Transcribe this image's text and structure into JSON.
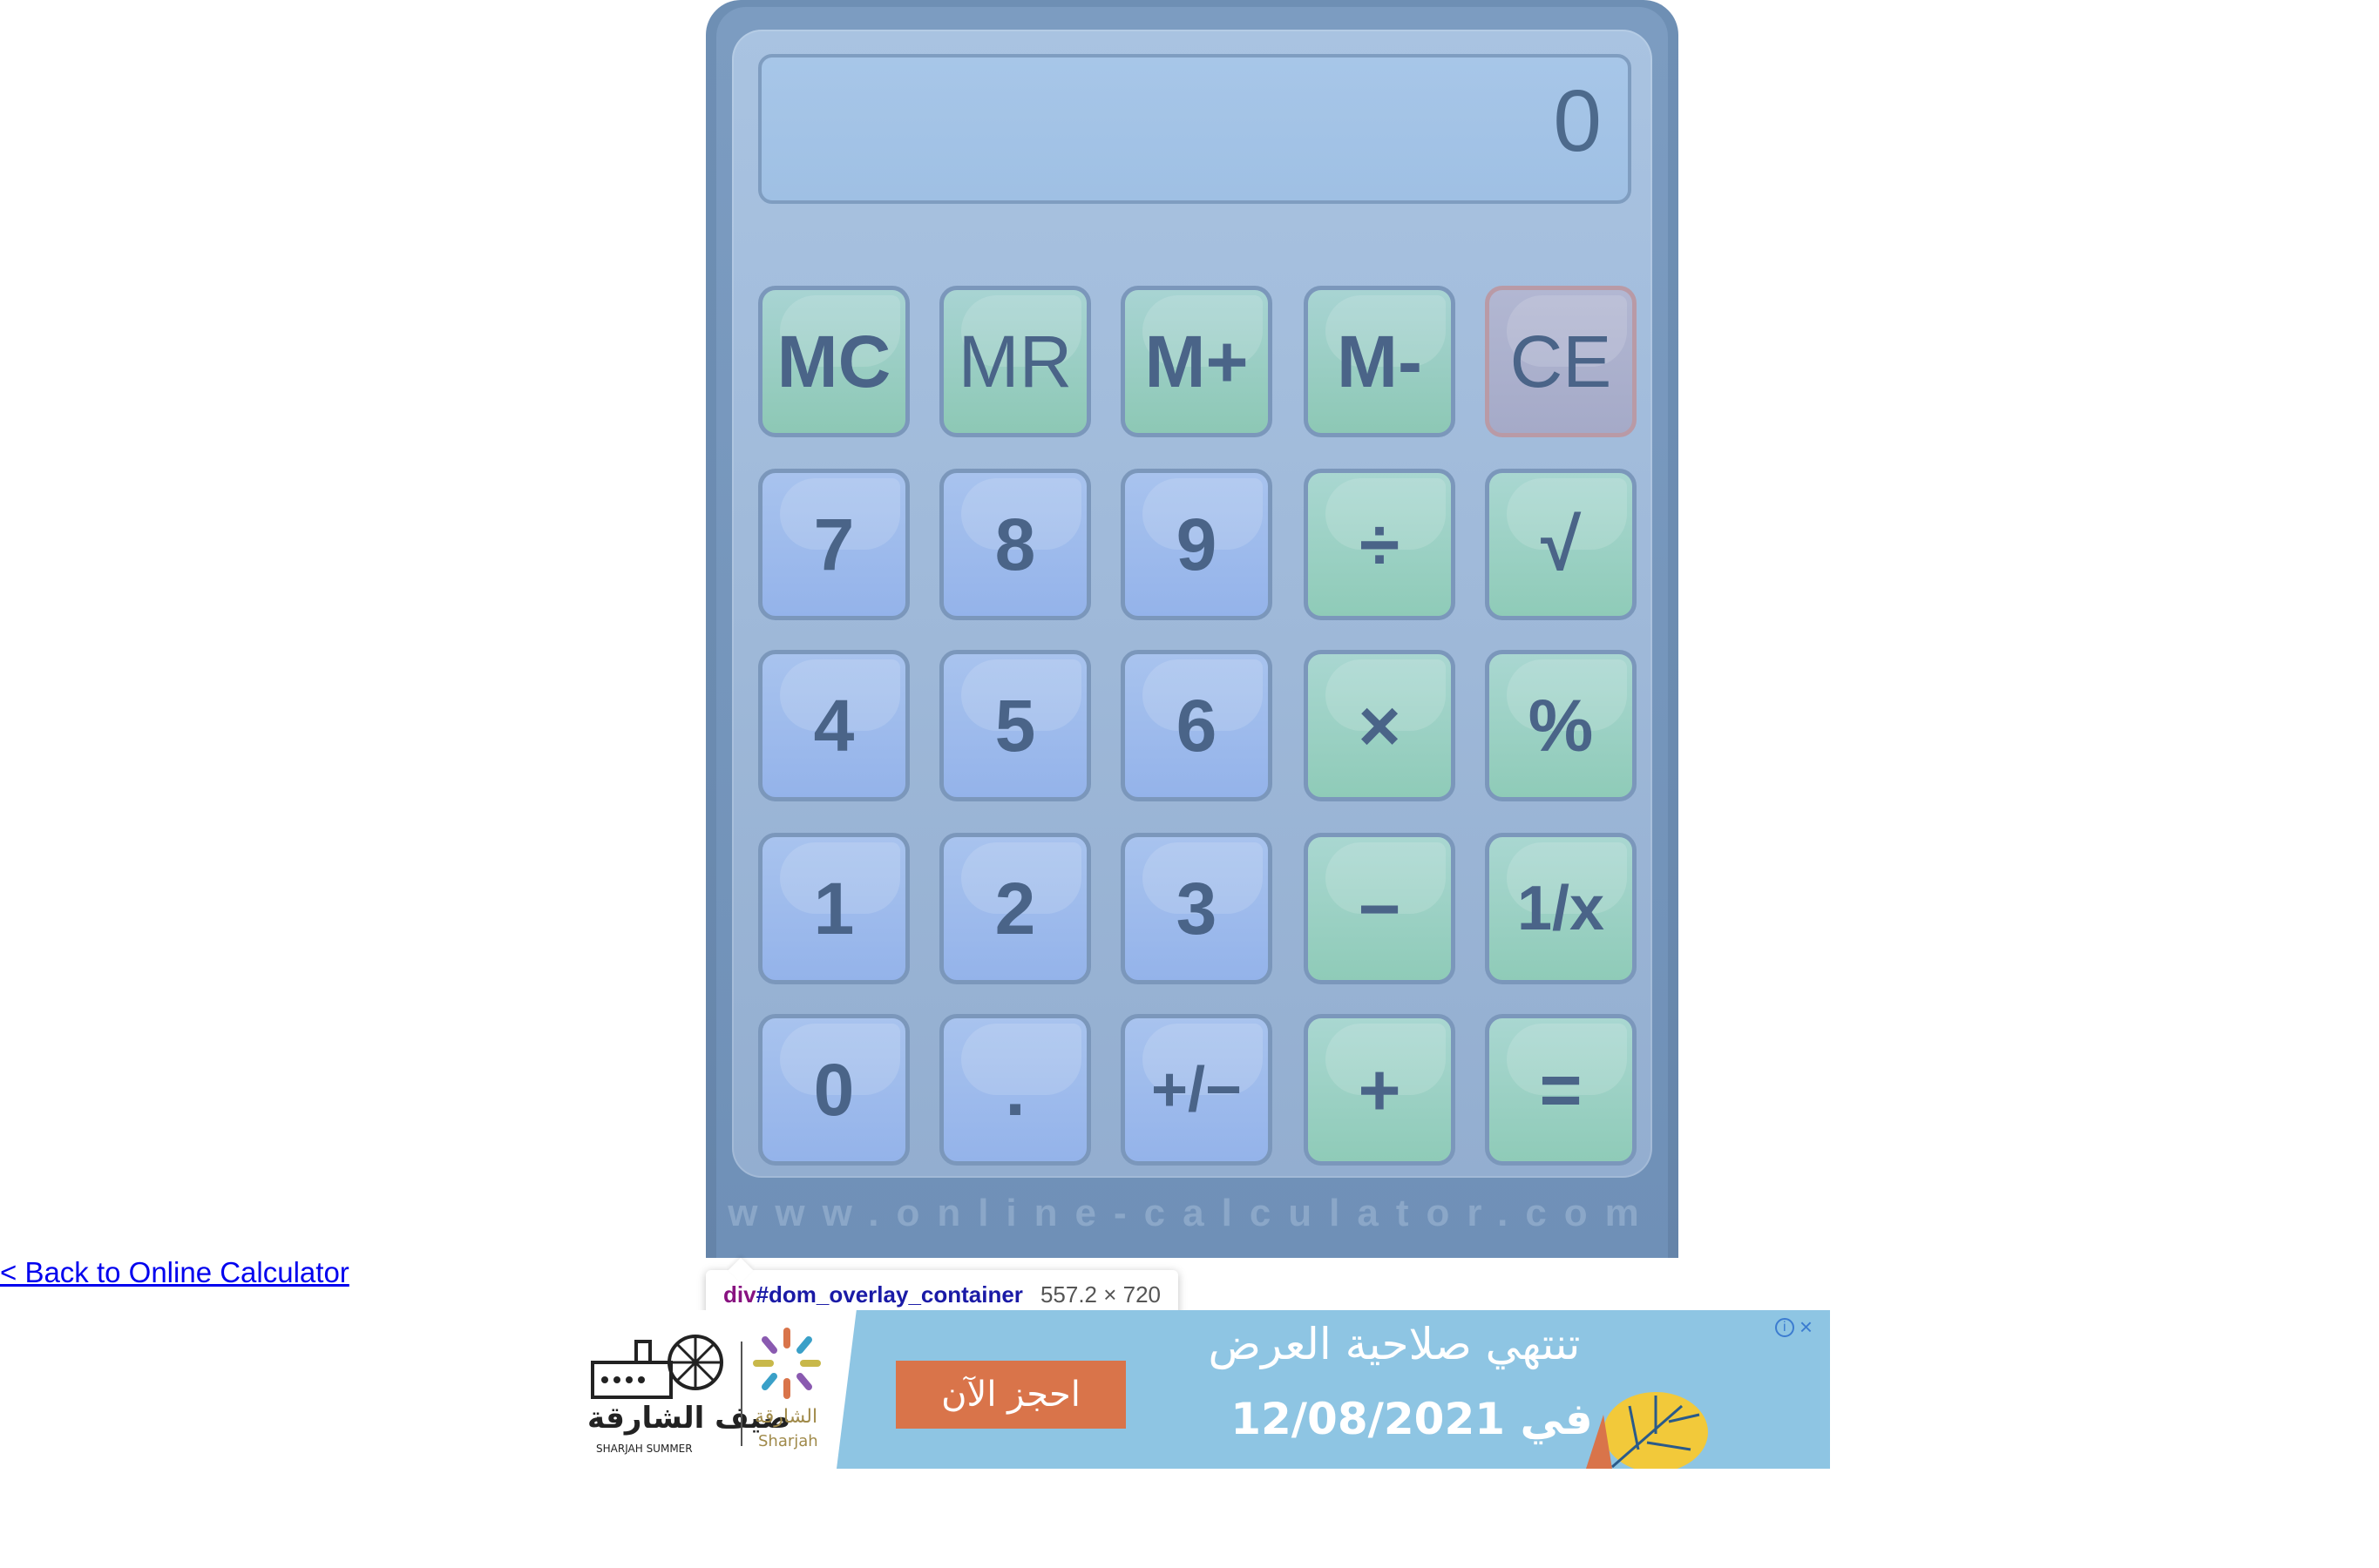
{
  "calculator": {
    "display_value": "0",
    "watermark": "www.online-calculator.com",
    "keys": [
      {
        "label": "MC",
        "name": "memory-clear-button",
        "type": "mem"
      },
      {
        "label": "MR",
        "name": "memory-recall-button",
        "type": "mem light"
      },
      {
        "label": "M+",
        "name": "memory-add-button",
        "type": "mem"
      },
      {
        "label": "M-",
        "name": "memory-subtract-button",
        "type": "mem"
      },
      {
        "label": "CE",
        "name": "clear-entry-button",
        "type": "ce"
      },
      {
        "label": "7",
        "name": "digit-7-button",
        "type": "num"
      },
      {
        "label": "8",
        "name": "digit-8-button",
        "type": "num"
      },
      {
        "label": "9",
        "name": "digit-9-button",
        "type": "num"
      },
      {
        "label": "÷",
        "name": "divide-button",
        "type": "op"
      },
      {
        "label": "√",
        "name": "square-root-button",
        "type": "op"
      },
      {
        "label": "4",
        "name": "digit-4-button",
        "type": "num"
      },
      {
        "label": "5",
        "name": "digit-5-button",
        "type": "num"
      },
      {
        "label": "6",
        "name": "digit-6-button",
        "type": "num"
      },
      {
        "label": "×",
        "name": "multiply-button",
        "type": "op"
      },
      {
        "label": "%",
        "name": "percent-button",
        "type": "op"
      },
      {
        "label": "1",
        "name": "digit-1-button",
        "type": "num"
      },
      {
        "label": "2",
        "name": "digit-2-button",
        "type": "num"
      },
      {
        "label": "3",
        "name": "digit-3-button",
        "type": "num"
      },
      {
        "label": "−",
        "name": "subtract-button",
        "type": "op"
      },
      {
        "label": "1/x",
        "name": "reciprocal-button",
        "type": "op"
      },
      {
        "label": "0",
        "name": "digit-0-button",
        "type": "num"
      },
      {
        "label": ".",
        "name": "decimal-point-button",
        "type": "num"
      },
      {
        "label": "+/−",
        "name": "plus-minus-button",
        "type": "num"
      },
      {
        "label": "+",
        "name": "add-button",
        "type": "op"
      },
      {
        "label": "=",
        "name": "equals-button",
        "type": "op"
      }
    ]
  },
  "back_link": "< Back to Online Calculator",
  "inspector": {
    "tag": "div",
    "id": "#dom_overlay_container",
    "size": "557.2 × 720"
  },
  "ad": {
    "cta": "احجز الآن",
    "headline": "تنتهي صلاحية العرض",
    "date_line": "في 12/08/2021",
    "logo_left_ar": "صيف الشارقة",
    "logo_left_en": "SHARJAH SUMMER",
    "logo_right_ar": "الشارقة",
    "logo_right_en": "Sharjah",
    "info_icon": "i",
    "close_icon": "×"
  },
  "colors": {
    "number_key": "#9cb9ec",
    "operator_key": "#99d0c3",
    "display_bg": "#a3c3e6",
    "case": "#6e8fb4",
    "ad_blue": "#8ec5e3",
    "ad_cta": "#d9744a"
  }
}
